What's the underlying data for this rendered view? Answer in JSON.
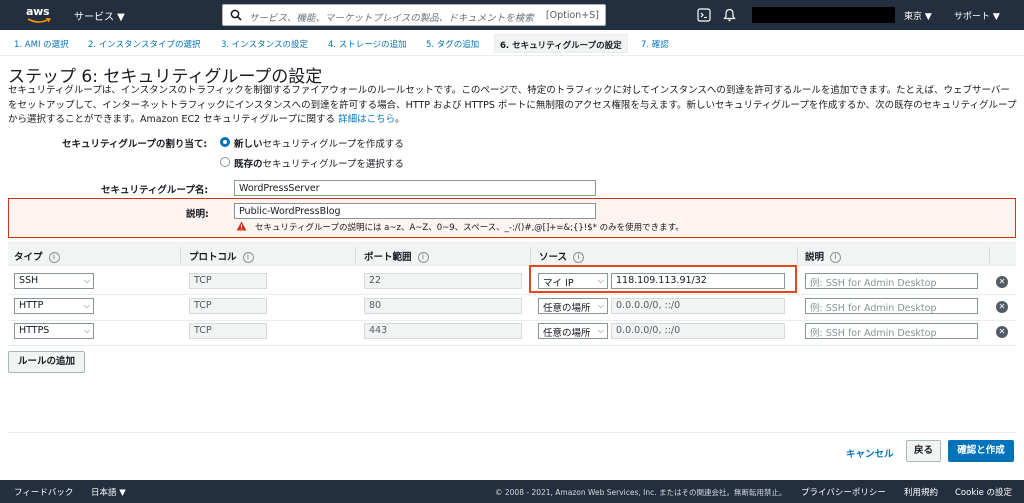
{
  "nav": {
    "logo_text": "aws",
    "services_label": "サービス ▼",
    "search_placeholder": "サービス、機能、マーケットプレイスの製品、ドキュメントを検索",
    "search_shortcut": "[Option+S]",
    "region": "東京 ▼",
    "support": "サポート ▼"
  },
  "steps": [
    "1. AMI の選択",
    "2. インスタンスタイプの選択",
    "3. インスタンスの設定",
    "4. ストレージの追加",
    "5. タグの追加",
    "6. セキュリティグループの設定",
    "7. 確認"
  ],
  "page": {
    "title": "ステップ 6: セキュリティグループの設定",
    "description": "セキュリティグループは、インスタンスのトラフィックを制御するファイアウォールのルールセットです。このページで、特定のトラフィックに対してインスタンスへの到達を許可するルールを追加できます。たとえば、ウェブサーバーをセットアップして、インターネットトラフィックにインスタンスへの到達を許可する場合、HTTP および HTTPS ポートに無制限のアクセス権限を与えます。新しいセキュリティグループを作成するか、次の既存のセキュリティグループから選択することができます。Amazon EC2 セキュリティグループに関する",
    "details_link": "詳細はこちら",
    "details_suffix": "。"
  },
  "form": {
    "assign_label": "セキュリティグループの割り当て:",
    "option_new_bold": "新しい",
    "option_new_rest": "セキュリティグループを作成する",
    "option_existing_bold": "既存の",
    "option_existing_rest": "セキュリティグループを選択する",
    "name_label": "セキュリティグループ名:",
    "name_value": "WordPressServer",
    "desc_label": "説明:",
    "desc_value": "Public-WordPressBlog",
    "warning": "セキュリティグループの説明には a~z、A~Z、0~9、スペース、_-:/()#,@[]+=&;{}!$* のみを使用できます。"
  },
  "table": {
    "headers": [
      "タイプ",
      "プロトコル",
      "ポート範囲",
      "ソース",
      "説明"
    ],
    "info_glyph": "i",
    "rows": [
      {
        "type": "SSH",
        "protocol": "TCP",
        "port": "22",
        "source_sel": "マイ IP",
        "source": "118.109.113.91/32",
        "desc_placeholder": "例: SSH for Admin Desktop"
      },
      {
        "type": "HTTP",
        "protocol": "TCP",
        "port": "80",
        "source_sel": "任意の場所",
        "source": "0.0.0.0/0, ::/0",
        "desc_placeholder": "例: SSH for Admin Desktop"
      },
      {
        "type": "HTTPS",
        "protocol": "TCP",
        "port": "443",
        "source_sel": "任意の場所",
        "source": "0.0.0.0/0, ::/0",
        "desc_placeholder": "例: SSH for Admin Desktop"
      }
    ],
    "add_rule": "ルールの追加"
  },
  "actions": {
    "cancel": "キャンセル",
    "back": "戻る",
    "review": "確認と作成"
  },
  "footer": {
    "feedback": "フィードバック",
    "language": "日本語 ▼",
    "copyright": "© 2008 - 2021, Amazon Web Services, Inc. またはその関連会社。無断転用禁止。",
    "privacy": "プライバシーポリシー",
    "terms": "利用規約",
    "cookie": "Cookie の設定"
  },
  "colors": {
    "nav_bg": "#232f3e",
    "link": "#0073bb",
    "highlight": "#e8441f",
    "error_border": "#d13212"
  }
}
